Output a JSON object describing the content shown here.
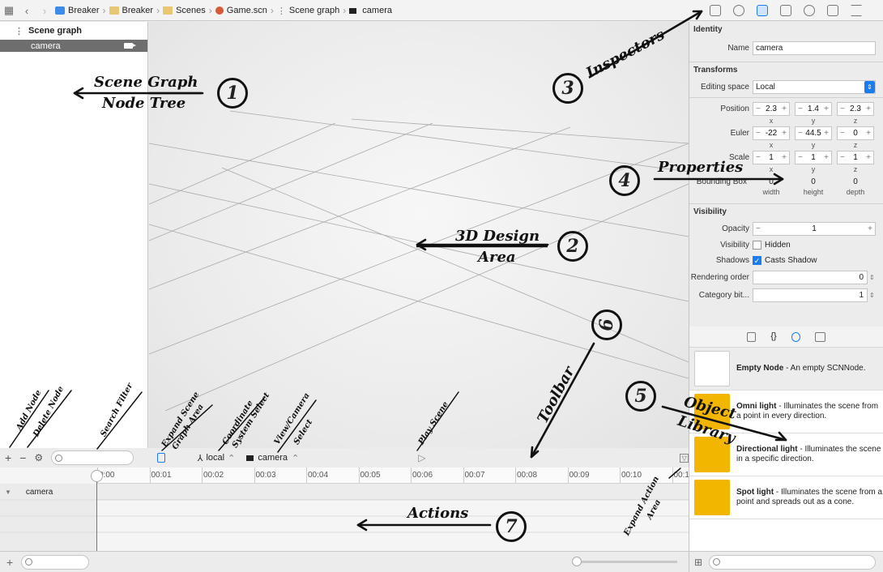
{
  "breadcrumb": [
    "Breaker",
    "Breaker",
    "Scenes",
    "Game.scn",
    "Scene graph",
    "camera"
  ],
  "scene_graph": {
    "header": "Scene graph",
    "node": "camera"
  },
  "toolbar": {
    "coord": "local",
    "camera": "camera"
  },
  "timeline": {
    "ticks": [
      "0:00",
      "00:01",
      "00:02",
      "00:03",
      "00:04",
      "00:05",
      "00:06",
      "00:07",
      "00:08",
      "00:09",
      "00:10",
      "00:1"
    ],
    "track": "camera"
  },
  "inspector": {
    "identity": {
      "title": "Identity",
      "name_label": "Name",
      "name_value": "camera"
    },
    "transforms": {
      "title": "Transforms",
      "editing_label": "Editing space",
      "editing_value": "Local",
      "position_label": "Position",
      "position": [
        "2.3",
        "1.4",
        "2.3"
      ],
      "euler_label": "Euler",
      "euler": [
        "-22",
        "44.5",
        "0"
      ],
      "scale_label": "Scale",
      "scale": [
        "1",
        "1",
        "1"
      ],
      "xyz": [
        "x",
        "y",
        "z"
      ],
      "bbox_label": "Bounding Box",
      "bbox": [
        "0",
        "0",
        "0"
      ],
      "bbox_sub": [
        "width",
        "height",
        "depth"
      ]
    },
    "visibility": {
      "title": "Visibility",
      "opacity_label": "Opacity",
      "opacity": "1",
      "visibility_label": "Visibility",
      "hidden": "Hidden",
      "shadows_label": "Shadows",
      "casts": "Casts Shadow",
      "rendering_label": "Rendering order",
      "rendering": "0",
      "category_label": "Category bit...",
      "category": "1"
    }
  },
  "library": [
    {
      "name": "Empty Node",
      "desc": " - An empty SCNNode.",
      "color": "#ffffff"
    },
    {
      "name": "Omni light",
      "desc": " - Illuminates the scene from a point in every direction.",
      "color": "#f2b600"
    },
    {
      "name": "Directional light",
      "desc": " - Illuminates the scene in a specific direction.",
      "color": "#f2b600"
    },
    {
      "name": "Spot light",
      "desc": " - Illuminates the scene from a point and spreads out as a cone.",
      "color": "#f2b600"
    }
  ],
  "annotations": {
    "a1": "Scene Graph",
    "a1b": "Node Tree",
    "a2": "3D Design",
    "a2b": "Area",
    "a3": "Inspectors",
    "a4": "Properties",
    "a5": "Object",
    "a5b": "Library",
    "a6": "Toolbar",
    "a7": "Actions",
    "add": "Add Node",
    "del": "Delete Node",
    "search": "Search Filter",
    "expand": "Expand Scene",
    "expandb": "Graph Area",
    "coord": "Coordinate",
    "coordb": "System Select",
    "view": "View/Camera",
    "viewb": "Select",
    "play": "Play Scene",
    "expact": "Expand Action",
    "expactb": "Area",
    "n1": "1",
    "n2": "2",
    "n3": "3",
    "n4": "4",
    "n5": "5",
    "n6": "6",
    "n7": "7"
  }
}
